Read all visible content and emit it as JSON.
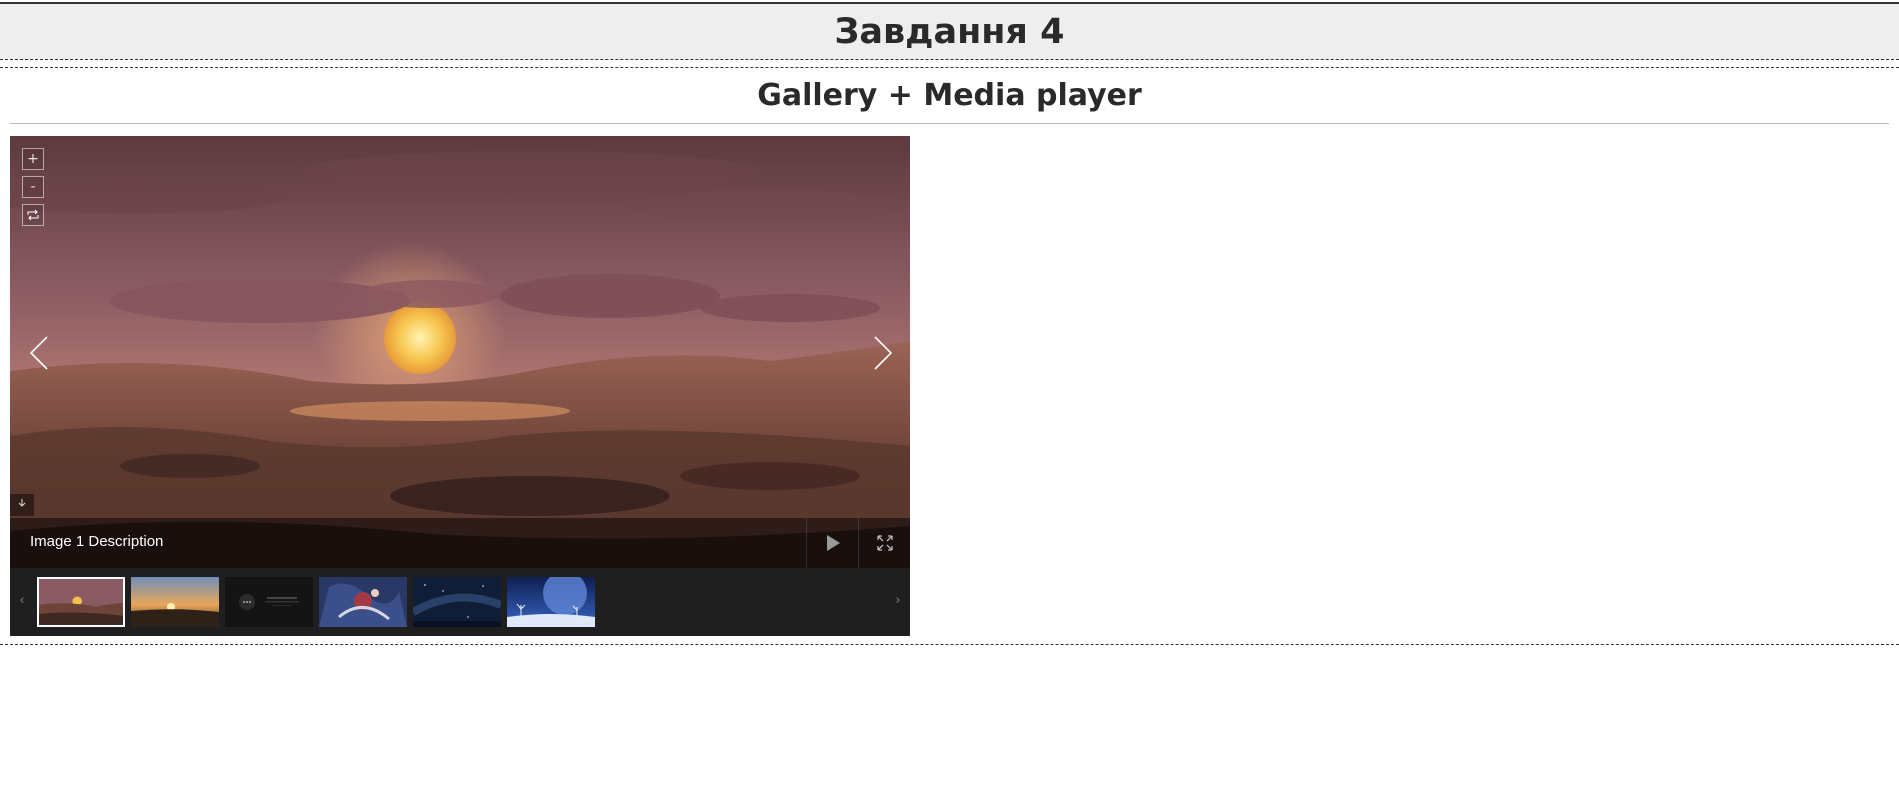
{
  "page": {
    "title": "Завдання 4"
  },
  "section": {
    "heading": "Gallery + Media player"
  },
  "gallery": {
    "caption": "Image 1 Description",
    "controls": {
      "zoom_in": "+",
      "zoom_out": "-"
    },
    "icons": {
      "zoom_in": "plus-icon",
      "zoom_out": "minus-icon",
      "rotate": "rotate-icon",
      "prev": "chevron-left-icon",
      "next": "chevron-right-icon",
      "download": "download-icon",
      "play": "play-icon",
      "fullscreen": "fullscreen-icon"
    },
    "thumbnails": [
      {
        "name": "Image 1 Description",
        "active": true
      },
      {
        "active": false
      },
      {
        "active": false
      },
      {
        "active": false
      },
      {
        "active": false
      },
      {
        "active": false
      }
    ]
  },
  "colors": {
    "header_bg": "#eeeeee",
    "gallery_bg": "#1f1f1f",
    "caption_bar": "rgba(0,0,0,0.48)"
  }
}
